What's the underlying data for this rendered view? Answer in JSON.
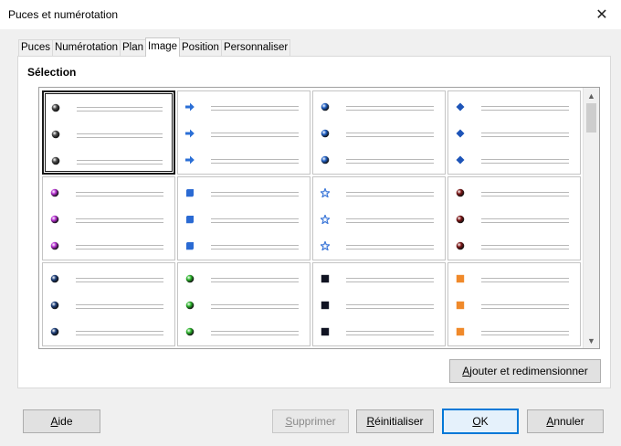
{
  "window": {
    "title": "Puces et numérotation",
    "close_glyph": "✕"
  },
  "tabs": [
    {
      "label": "Puces"
    },
    {
      "label": "Numérotation"
    },
    {
      "label": "Plan"
    },
    {
      "label": "Image"
    },
    {
      "label": "Position"
    },
    {
      "label": "Personnaliser"
    }
  ],
  "active_tab": "Image",
  "selection": {
    "label": "Sélection",
    "selected_index": 0,
    "bullets": [
      {
        "icon": "gray-sphere-bullet",
        "color": "#4a4a4a"
      },
      {
        "icon": "blue-arrow-bullet",
        "color": "#2b6fd6"
      },
      {
        "icon": "blue-sphere-bullet",
        "color": "#1f5fc4"
      },
      {
        "icon": "blue-diamond-bullet",
        "color": "#1d54b8"
      },
      {
        "icon": "purple-sphere-bullet",
        "color": "#b62fd1"
      },
      {
        "icon": "blue-cube-bullet",
        "color": "#2a6ad3"
      },
      {
        "icon": "blue-star-bullet",
        "color": "#3d78d8"
      },
      {
        "icon": "dark-red-sphere-bullet",
        "color": "#7b1414"
      },
      {
        "icon": "navy-sphere-bullet",
        "color": "#1d3f7a"
      },
      {
        "icon": "green-sphere-bullet",
        "color": "#2bb52b"
      },
      {
        "icon": "black-square-bullet",
        "color": "#101322"
      },
      {
        "icon": "orange-square-bullet",
        "color": "#f0892a"
      }
    ]
  },
  "buttons": {
    "add_resize": {
      "pre": "",
      "mnemonic": "A",
      "post": "jouter et redimensionner"
    },
    "help": {
      "pre": "",
      "mnemonic": "A",
      "post": "ide"
    },
    "delete": {
      "pre": "",
      "mnemonic": "S",
      "post": "upprimer"
    },
    "reset": {
      "pre": "",
      "mnemonic": "R",
      "post": "éinitialiser"
    },
    "ok": {
      "pre": "",
      "mnemonic": "O",
      "post": "K"
    },
    "cancel": {
      "pre": "",
      "mnemonic": "A",
      "post": "nnuler"
    }
  },
  "scrollbar": {
    "up_glyph": "▲",
    "down_glyph": "▼"
  }
}
